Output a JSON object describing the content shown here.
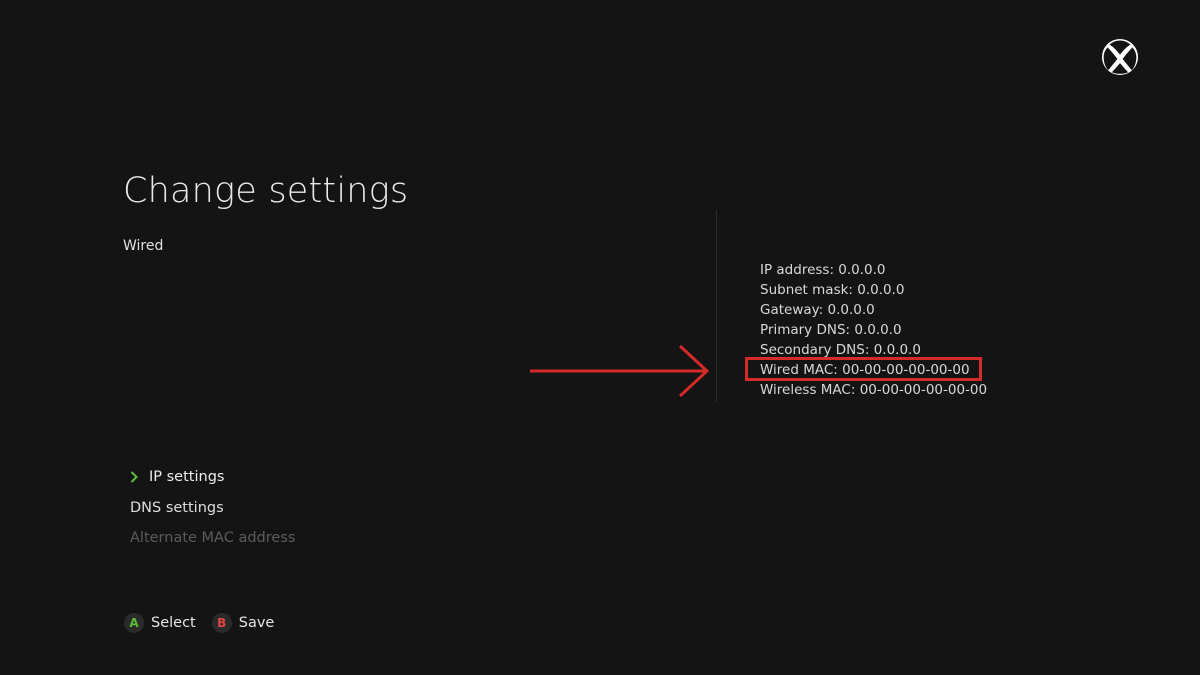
{
  "header": {
    "logo_icon": "xbox-logo-icon"
  },
  "page": {
    "title": "Change settings",
    "subtitle": "Wired"
  },
  "network_info": {
    "ip_address": "IP address: 0.0.0.0",
    "subnet_mask": "Subnet mask: 0.0.0.0",
    "gateway": "Gateway: 0.0.0.0",
    "primary_dns": "Primary DNS: 0.0.0.0",
    "secondary_dns": "Secondary DNS: 0.0.0.0",
    "wired_mac": "Wired MAC: 00-00-00-00-00-00",
    "wireless_mac": "Wireless MAC: 00-00-00-00-00-00"
  },
  "annotation": {
    "highlighted_item": "Wired MAC",
    "color": "#d42a2a"
  },
  "menu": {
    "items": [
      {
        "label": "IP settings",
        "state": "selected",
        "icon": "chevron-right-icon"
      },
      {
        "label": "DNS settings",
        "state": "normal"
      },
      {
        "label": "Alternate MAC address",
        "state": "disabled"
      }
    ]
  },
  "footer": {
    "a_key": "A",
    "a_label": "Select",
    "b_key": "B",
    "b_label": "Save"
  },
  "colors": {
    "background": "#141414",
    "accent_green": "#5cbf3a",
    "accent_red": "#e0463f",
    "annotation_red": "#d42a2a"
  }
}
